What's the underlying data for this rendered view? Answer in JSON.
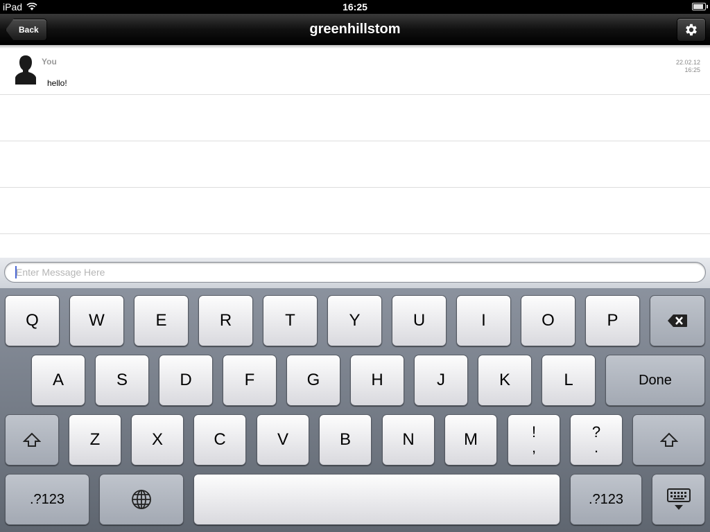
{
  "status_bar": {
    "device": "iPad",
    "time": "16:25"
  },
  "nav": {
    "back_label": "Back",
    "title": "greenhillstom"
  },
  "messages": [
    {
      "sender": "You",
      "text": "hello!",
      "date": "22.02.12",
      "time": "16:25"
    }
  ],
  "input": {
    "placeholder": "Enter Message Here",
    "value": ""
  },
  "keyboard": {
    "row1": [
      "Q",
      "W",
      "E",
      "R",
      "T",
      "Y",
      "U",
      "I",
      "O",
      "P"
    ],
    "row2": [
      "A",
      "S",
      "D",
      "F",
      "G",
      "H",
      "J",
      "K",
      "L"
    ],
    "done": "Done",
    "row3": [
      "Z",
      "X",
      "C",
      "V",
      "B",
      "N",
      "M"
    ],
    "punct1": [
      "!",
      ","
    ],
    "punct2": [
      "?",
      "."
    ],
    "numbers_label": ".?123"
  },
  "icons": {
    "settings": "gear-icon",
    "avatar": "user-silhouette-icon",
    "backspace": "backspace-icon",
    "shift": "shift-arrow-icon",
    "globe": "globe-icon",
    "hide_keyboard": "keyboard-hide-icon",
    "wifi": "wifi-icon",
    "battery": "battery-icon"
  }
}
